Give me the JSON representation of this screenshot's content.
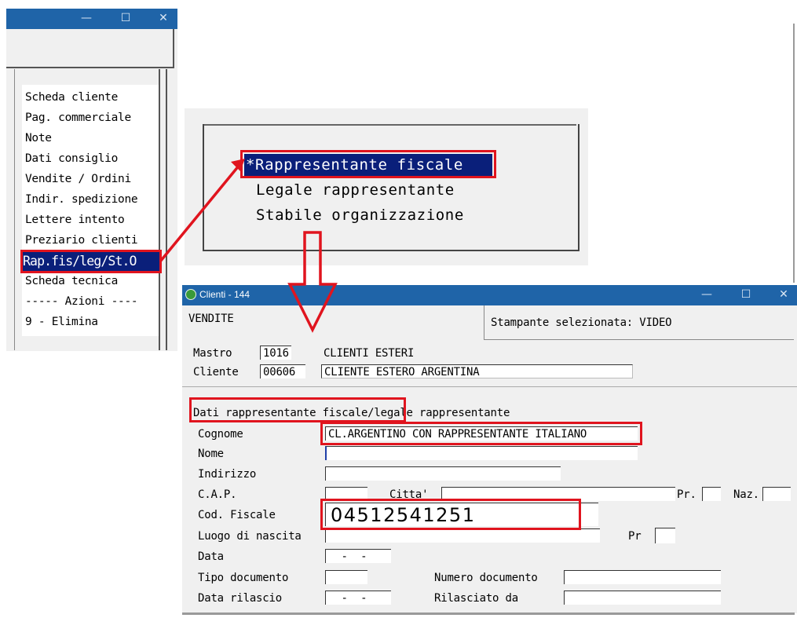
{
  "left_window": {
    "titlebar": {
      "minimize": "—",
      "maximize": "☐",
      "close": "✕"
    },
    "menu_items": [
      "Scheda cliente",
      "Pag. commerciale",
      "Note",
      "Dati consiglio",
      "Vendite / Ordini",
      "Indir. spedizione",
      "Lettere intento",
      "Preziario clienti",
      "Rap.fis/leg/St.O",
      "Scheda tecnica",
      "----- Azioni ----",
      "9 - Elimina"
    ],
    "selected_index": 8
  },
  "popup": {
    "items": [
      "*Rappresentante fiscale",
      "Legale rappresentante",
      "Stabile organizzazione"
    ]
  },
  "main_window": {
    "title": "Clienti - 144",
    "titlebar": {
      "minimize": "—",
      "maximize": "☐",
      "close": "✕"
    },
    "module": "VENDITE",
    "printer": "Stampante selezionata: VIDEO",
    "mastro": {
      "label": "Mastro",
      "code": "1016",
      "description": "CLIENTI ESTERI"
    },
    "cliente": {
      "label": "Cliente",
      "code": "00606",
      "description": "CLIENTE ESTERO ARGENTINA"
    },
    "section_title": "Dati rappresentante fiscale/legale rappresentante",
    "fields": {
      "cognome": {
        "label": "Cognome",
        "value": "CL.ARGENTINO CON RAPPRESENTANTE ITALIANO"
      },
      "nome": {
        "label": "Nome",
        "value": ""
      },
      "indirizzo": {
        "label": "Indirizzo",
        "value": ""
      },
      "cap": {
        "label": "C.A.P.",
        "value": ""
      },
      "citta": {
        "label": "Citta'",
        "value": ""
      },
      "pr": {
        "label": "Pr.",
        "value": ""
      },
      "naz": {
        "label": "Naz.",
        "value": ""
      },
      "cod_fiscale": {
        "label": "Cod. Fiscale",
        "value": "04512541251"
      },
      "luogo_nascita": {
        "label": "Luogo di nascita",
        "value": ""
      },
      "pr_nascita": {
        "label": "Pr",
        "value": ""
      },
      "data": {
        "label": "Data",
        "value": "  -  -"
      },
      "tipo_documento": {
        "label": "Tipo documento",
        "value": ""
      },
      "numero_documento": {
        "label": "Numero documento",
        "value": ""
      },
      "data_rilascio": {
        "label": "Data rilascio",
        "value": "  -  -"
      },
      "rilasciato_da": {
        "label": "Rilasciato da",
        "value": ""
      }
    }
  },
  "annotation_colors": {
    "highlight": "#e0141e",
    "selection": "#0a1f7a",
    "titlebar": "#1f64a8"
  }
}
